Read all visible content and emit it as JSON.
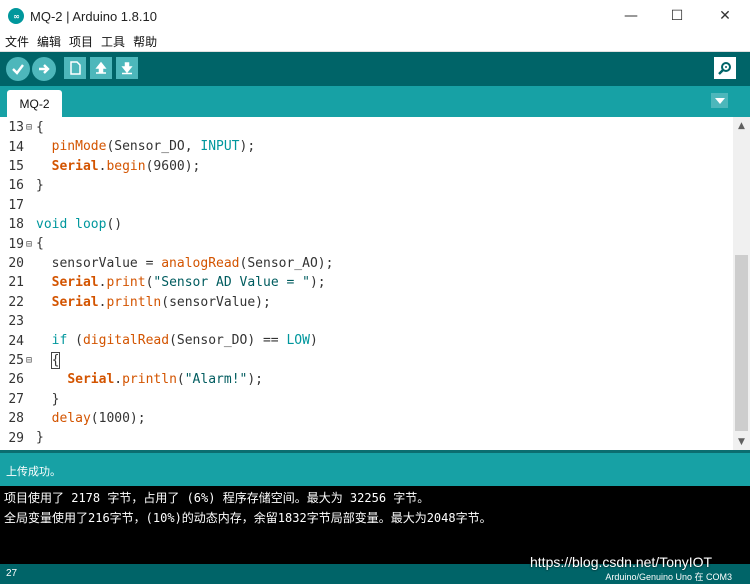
{
  "window": {
    "title": "MQ-2 | Arduino 1.8.10",
    "app_icon_text": "∞",
    "minimize_glyph": "—",
    "maximize_glyph": "☐",
    "close_glyph": "✕"
  },
  "menu": {
    "items": [
      "文件",
      "编辑",
      "项目",
      "工具",
      "帮助"
    ]
  },
  "toolbar": {
    "icons": [
      "verify-icon",
      "upload-icon",
      "new-icon",
      "open-icon",
      "save-icon",
      "serial-monitor-icon"
    ],
    "accent": "#4db7bb",
    "background": "#006468"
  },
  "tabs": {
    "active": "MQ-2"
  },
  "editor": {
    "lines": [
      {
        "num": "13",
        "fold": "⊟",
        "code": "{"
      },
      {
        "num": "14",
        "fold": "",
        "code": "  pinMode(Sensor_DO, INPUT);"
      },
      {
        "num": "15",
        "fold": "",
        "code": "  Serial.begin(9600);"
      },
      {
        "num": "16",
        "fold": "",
        "code": "}"
      },
      {
        "num": "17",
        "fold": "",
        "code": ""
      },
      {
        "num": "18",
        "fold": "",
        "code": "void loop()"
      },
      {
        "num": "19",
        "fold": "⊟",
        "code": "{"
      },
      {
        "num": "20",
        "fold": "",
        "code": "  sensorValue = analogRead(Sensor_AO);"
      },
      {
        "num": "21",
        "fold": "",
        "code": "  Serial.print(\"Sensor AD Value = \");"
      },
      {
        "num": "22",
        "fold": "",
        "code": "  Serial.println(sensorValue);"
      },
      {
        "num": "23",
        "fold": "",
        "code": ""
      },
      {
        "num": "24",
        "fold": "",
        "code": "  if (digitalRead(Sensor_DO) == LOW)"
      },
      {
        "num": "25",
        "fold": "⊟",
        "code": "  {"
      },
      {
        "num": "26",
        "fold": "",
        "code": "    Serial.println(\"Alarm!\");"
      },
      {
        "num": "27",
        "fold": "",
        "code": "  }"
      },
      {
        "num": "28",
        "fold": "",
        "code": "  delay(1000);"
      },
      {
        "num": "29",
        "fold": "",
        "code": "}"
      }
    ]
  },
  "status": {
    "message": "上传成功。"
  },
  "console": {
    "lines": [
      "项目使用了 2178 字节，占用了 (6%) 程序存储空间。最大为 32256 字节。",
      "全局变量使用了216字节，(10%)的动态内存，余留1832字节局部变量。最大为2048字节。"
    ]
  },
  "footer": {
    "line_number": "27",
    "board": "Arduino/Genuino Uno 在 COM3",
    "watermark": "https://blog.csdn.net/TonyIOT"
  }
}
